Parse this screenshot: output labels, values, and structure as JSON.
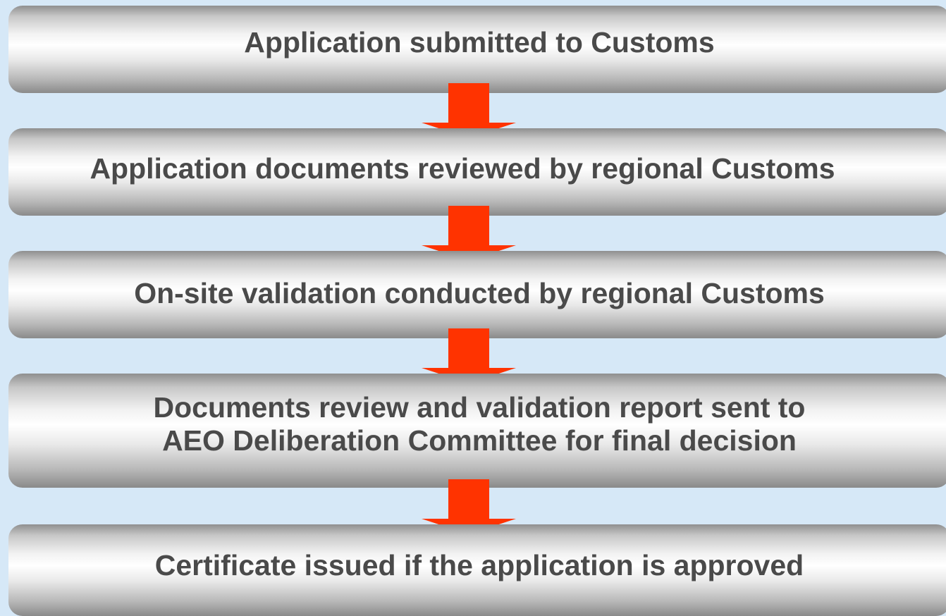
{
  "flowchart": {
    "steps": [
      {
        "text": "Application submitted to Customs"
      },
      {
        "text": "Application documents reviewed by regional Customs"
      },
      {
        "text": "On-site validation conducted by regional Customs"
      },
      {
        "text": "Documents review and validation report sent to\nAEO Deliberation Committee for final decision"
      },
      {
        "text": "Certificate issued if the application is approved"
      }
    ],
    "arrow_color": "#ff3300",
    "background_color": "#d6e8f7",
    "text_color": "#4a4a4a"
  }
}
